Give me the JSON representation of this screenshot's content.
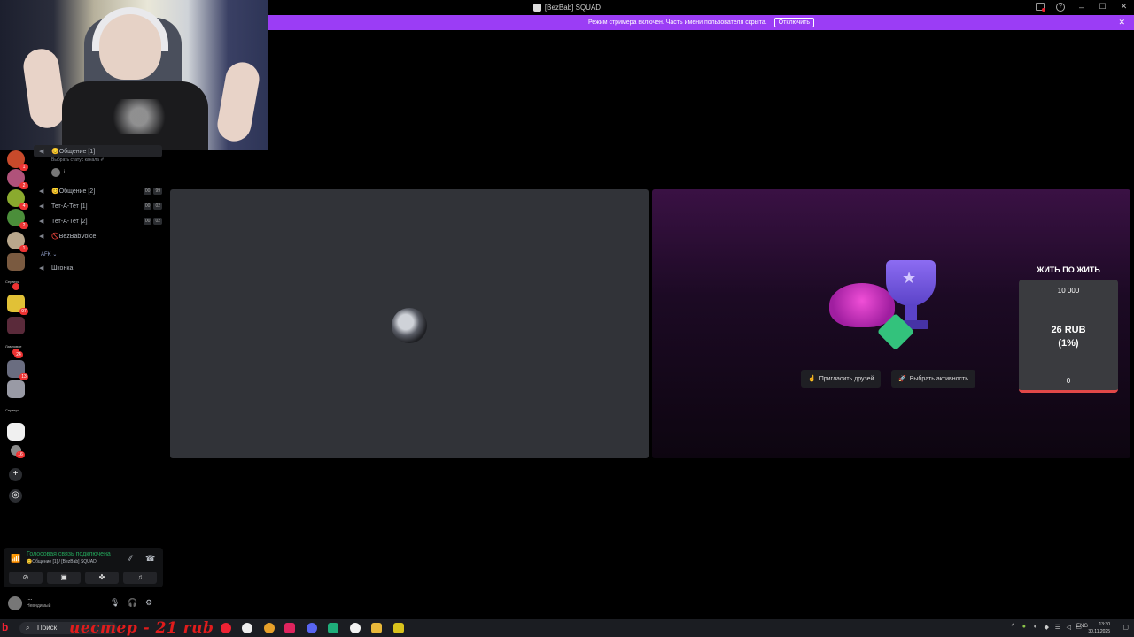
{
  "window": {
    "title": "[BezBab] SQUAD"
  },
  "banner": {
    "text": "Режим стримера включен. Часть имени пользователя скрыта.",
    "button": "Отключить"
  },
  "servers": {
    "badges": [
      "1",
      "2",
      "4",
      "2",
      "1",
      "2",
      "97",
      "24",
      "13",
      "16"
    ],
    "folders": [
      "Сервера",
      "Ламповое",
      "Сервера"
    ]
  },
  "channels": {
    "active_channel": "😊Общение [1]",
    "status_hint": "Выбрать статус канала ✐",
    "member_name": "i...",
    "list": [
      {
        "name": "😊Общение [2]",
        "c1": "00",
        "c2": "99"
      },
      {
        "name": "Тет-А-Тет [1]",
        "c1": "00",
        "c2": "02"
      },
      {
        "name": "Тет-А-Тет [2]",
        "c1": "00",
        "c2": "02"
      },
      {
        "name": "🚫BezBabVoice",
        "c1": "",
        "c2": ""
      }
    ],
    "afk_category": "AFK ⌄",
    "afk_channel": "Шконка"
  },
  "voice": {
    "title": "Голосовая связь подключена",
    "subtitle": "😊Общение [1] / [BezBab] SQUAD"
  },
  "user": {
    "name": "i...",
    "status": "Невидимый"
  },
  "activity": {
    "invite_button": "Пригласить друзей",
    "choose_button": "Выбрать активность"
  },
  "donation": {
    "title": "ЖИТЬ ПО ЖИТЬ",
    "goal": "10 000",
    "amount": "26 RUB",
    "percent": "(1%)",
    "min": "0",
    "progress_fraction": 0.01
  },
  "taskbar": {
    "search": "Поиск",
    "overlay_text": "иестер - 21 rub",
    "lang": "ENG",
    "time": "13:30",
    "date": "30.11.2025"
  },
  "colors": {
    "banner": "#9b3df5",
    "voice_green": "#23a55a",
    "progress_red": "#e14848"
  }
}
